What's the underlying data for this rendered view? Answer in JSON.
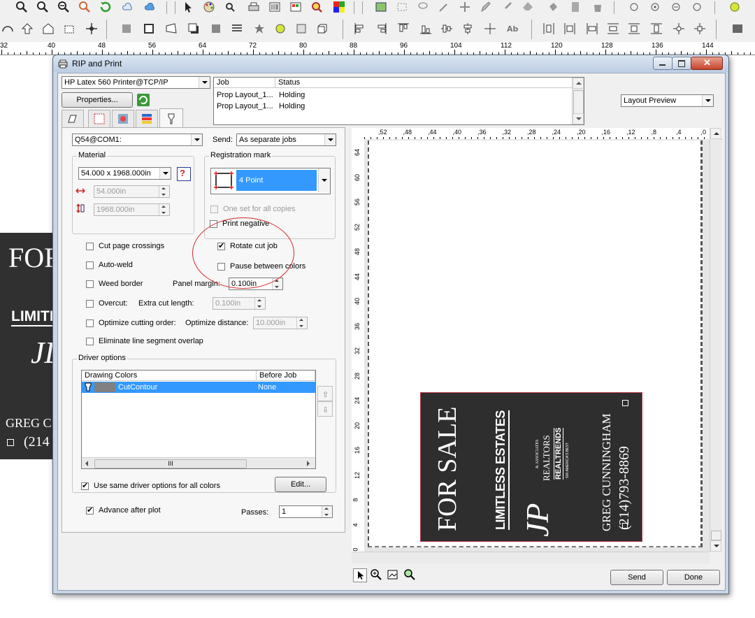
{
  "ruler": {
    "labels": [
      "32",
      "40",
      "48",
      "56",
      "64",
      "72",
      "80",
      "88",
      "96",
      "104",
      "112",
      "120",
      "128",
      "136",
      "144"
    ]
  },
  "background_sign": {
    "line1": "FOR",
    "line2": "LIMITL",
    "line3": "GREG C",
    "line4": "(214"
  },
  "window": {
    "title": "RIP and Print",
    "printer": "HP Latex 560 Printer@TCP/IP",
    "properties_label": "Properties...",
    "jobs": {
      "headers": [
        "Job",
        "Status"
      ],
      "rows": [
        {
          "job": "Prop Layout_1...",
          "status": "Holding"
        },
        {
          "job": "Prop Layout_1...",
          "status": "Holding"
        }
      ]
    },
    "preview_mode": "Layout Preview",
    "port": "Q54@COM1:",
    "send_label": "Send:",
    "send_value": "As separate jobs",
    "material": {
      "group_label": "Material",
      "size": "54.000 x 1968.000in",
      "width": "54.000in",
      "length": "1968.000in"
    },
    "registration": {
      "group_label": "Registration mark",
      "value": "4 Point",
      "one_set_label": "One set for all copies"
    },
    "options": {
      "print_negative": "Print negative",
      "cut_page_crossings": "Cut page crossings",
      "rotate_cut_job": "Rotate cut job",
      "auto_weld": "Auto-weld",
      "pause_between_colors": "Pause between colors",
      "weed_border": "Weed border",
      "panel_margin_label": "Panel margin:",
      "panel_margin": "0.100in",
      "overcut": "Overcut:",
      "extra_cut_label": "Extra cut length:",
      "extra_cut": "0.100in",
      "optimize_cutting": "Optimize cutting order:",
      "optimize_distance_label": "Optimize distance:",
      "optimize_distance": "10.000in",
      "eliminate_overlap": "Eliminate line segment overlap"
    },
    "driver": {
      "group_label": "Driver options",
      "headers": [
        "Drawing Colors",
        "Before Job"
      ],
      "row": {
        "name": "CutContour",
        "before": "None"
      },
      "scroll_thumb": "III",
      "same_options_label": "Use same driver options for all colors",
      "edit_label": "Edit..."
    },
    "advance_after_plot": "Advance after plot",
    "passes_label": "Passes:",
    "passes": "1",
    "send_button": "Send",
    "done_button": "Done"
  },
  "preview": {
    "hruler": [
      ",52",
      ",48",
      ",44",
      ",40",
      ",36",
      ",32",
      ",28",
      ",24",
      ",20",
      ",16",
      ",12",
      ",8",
      ",4",
      ",0"
    ],
    "vruler": [
      "64",
      "60",
      "56",
      "52",
      "48",
      "44",
      "40",
      "36",
      "32",
      "28",
      "24",
      "20",
      "16",
      "12",
      "8",
      "4",
      "0"
    ],
    "sign": {
      "for_sale": "FOR SALE",
      "limitless": "LIMITLESS ESTATES",
      "jp": "JP",
      "associates": "& ASSOCIATES",
      "realtors": "REALTORS",
      "realtrends": "REALTRENDS",
      "rankings": "500 AMERICA'S BEST",
      "name": "GREG CUNNINGHAM",
      "phone": "(214)793-8869"
    }
  },
  "colors": {
    "accent": "#3399ff",
    "sign_bg": "#2e2e2e",
    "annotation": "#d42b2b"
  }
}
